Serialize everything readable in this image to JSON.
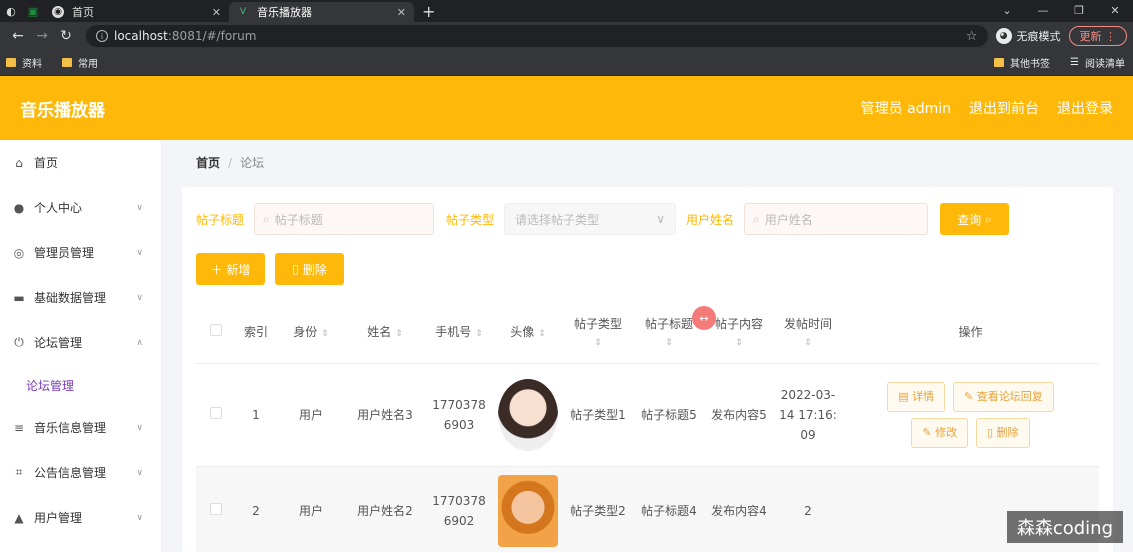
{
  "browser": {
    "tabs": [
      {
        "label": "首页",
        "active": false
      },
      {
        "label": "音乐播放器",
        "active": true
      }
    ],
    "url_host": "localhost",
    "url_path": ":8081/#/forum",
    "incognito_label": "无痕模式",
    "update_label": "更新",
    "bookmarks": [
      "资料",
      "常用"
    ],
    "bookmarks_right": [
      "其他书签",
      "阅读清单"
    ]
  },
  "app": {
    "title": "音乐播放器",
    "header_links": [
      "管理员 admin",
      "退出到前台",
      "退出登录"
    ],
    "accent": "#fdb80a"
  },
  "sidebar": {
    "items": [
      {
        "label": "首页",
        "icon": "home-icon",
        "expandable": false
      },
      {
        "label": "个人中心",
        "icon": "user-icon",
        "expandable": true
      },
      {
        "label": "管理员管理",
        "icon": "compass-icon",
        "expandable": true
      },
      {
        "label": "基础数据管理",
        "icon": "monitor-icon",
        "expandable": true
      },
      {
        "label": "论坛管理",
        "icon": "power-icon",
        "expandable": true,
        "expanded": true
      }
    ],
    "sub_item": "论坛管理",
    "items_after": [
      {
        "label": "音乐信息管理",
        "icon": "list-icon",
        "expandable": true
      },
      {
        "label": "公告信息管理",
        "icon": "crop-icon",
        "expandable": true
      },
      {
        "label": "用户管理",
        "icon": "person-icon",
        "expandable": true
      }
    ]
  },
  "breadcrumb": {
    "home": "首页",
    "current": "论坛"
  },
  "search": {
    "title_label": "帖子标题",
    "title_placeholder": "帖子标题",
    "type_label": "帖子类型",
    "type_placeholder": "请选择帖子类型",
    "user_label": "用户姓名",
    "user_placeholder": "用户姓名",
    "query_button": "查询"
  },
  "actions": {
    "add": "新增",
    "delete": "删除"
  },
  "table": {
    "headers": [
      "索引",
      "身份",
      "姓名",
      "手机号",
      "头像",
      "帖子类型",
      "帖子标题",
      "帖子内容",
      "发帖时间",
      "操作"
    ],
    "rows": [
      {
        "index": "1",
        "role": "用户",
        "name": "用户姓名3",
        "phone": "17703786903",
        "type": "帖子类型1",
        "title": "帖子标题5",
        "content": "发布内容5",
        "time": "2022-03-14 17:16:09"
      },
      {
        "index": "2",
        "role": "用户",
        "name": "用户姓名2",
        "phone": "17703786902",
        "type": "帖子类型2",
        "title": "帖子标题4",
        "content": "发布内容4",
        "time": "2"
      }
    ],
    "row_buttons": [
      "详情",
      "查看论坛回复",
      "修改",
      "删除"
    ]
  },
  "watermark": "森森coding"
}
